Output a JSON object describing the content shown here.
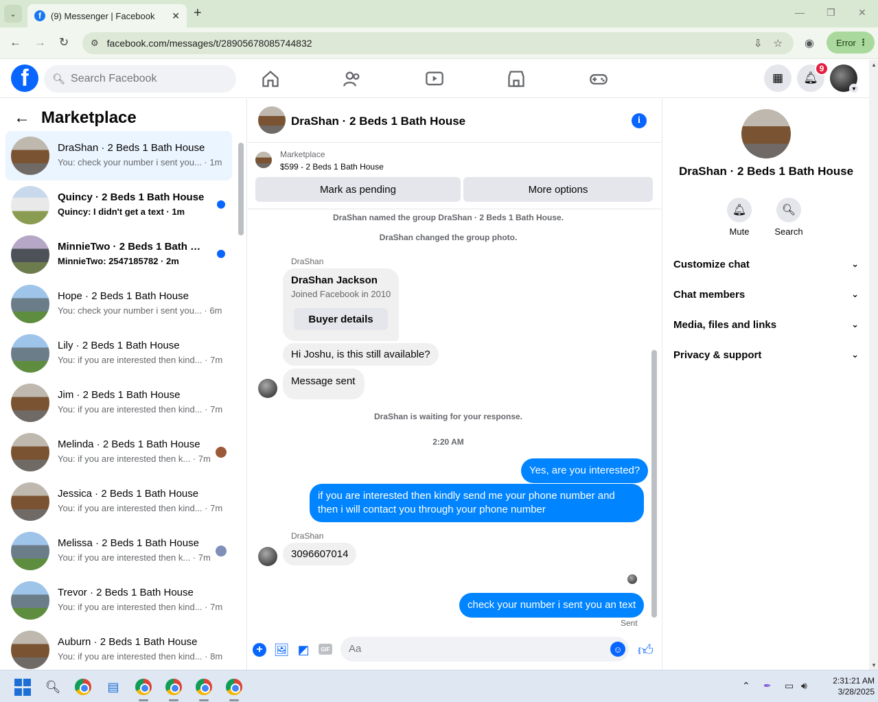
{
  "browser": {
    "tab_title": "(9) Messenger | Facebook",
    "url": "facebook.com/messages/t/28905678085744832",
    "error_label": "Error"
  },
  "fb_header": {
    "search_placeholder": "Search Facebook",
    "notification_count": "9"
  },
  "left_panel": {
    "title": "Marketplace",
    "conversations": [
      {
        "name": "DraShan · 2 Beds 1 Bath House",
        "preview": "You: check your number i sent you... · 1m",
        "thumb": "room",
        "active": true,
        "unread": false
      },
      {
        "name": "Quincy · 2 Beds 1 Bath House",
        "preview": "Quincy: I didn't get a text · 1m",
        "thumb": "white",
        "unread": true
      },
      {
        "name": "MinnieTwo · 2 Beds 1 Bath Ho...",
        "preview": "MinnieTwo: 2547185782 · 2m",
        "thumb": "gray",
        "unread": true
      },
      {
        "name": "Hope · 2 Beds 1 Bath House",
        "preview": "You: check your number i sent you... · 6m",
        "thumb": "house"
      },
      {
        "name": "Lily · 2 Beds 1 Bath House",
        "preview": "You: if you are interested then kind... · 7m",
        "thumb": "house"
      },
      {
        "name": "Jim · 2 Beds 1 Bath House",
        "preview": "You: if you are interested then kind... · 7m",
        "thumb": "room"
      },
      {
        "name": "Melinda · 2 Beds 1 Bath House",
        "preview": "You: if you are interested then k... · 7m",
        "thumb": "room",
        "mini": "#9a5a3a"
      },
      {
        "name": "Jessica · 2 Beds 1 Bath House",
        "preview": "You: if you are interested then kind... · 7m",
        "thumb": "room"
      },
      {
        "name": "Melissa · 2 Beds 1 Bath House",
        "preview": "You: if you are interested then k... · 7m",
        "thumb": "house",
        "mini": "#7f8fb8"
      },
      {
        "name": "Trevor · 2 Beds 1 Bath House",
        "preview": "You: if you are interested then kind... · 7m",
        "thumb": "house"
      },
      {
        "name": "Auburn · 2 Beds 1 Bath House",
        "preview": "You: if you are interested then kind... · 8m",
        "thumb": "room"
      }
    ]
  },
  "chat": {
    "header_name": "DraShan · 2 Beds 1 Bath House",
    "marketplace_label": "Marketplace",
    "listing": "$599 - 2 Beds 1 Bath House",
    "mark_pending": "Mark as pending",
    "more_options": "More options",
    "sys_named": "DraShan named the group DraShan · 2 Beds 1 Bath House.",
    "sys_photo": "DraShan changed the group photo.",
    "sender1": "DraShan",
    "card_name": "DraShan Jackson",
    "card_sub": "Joined Facebook in 2010",
    "card_button": "Buyer details",
    "msg_available": "Hi Joshu, is this still available?",
    "msg_sent": "Message sent",
    "sys_waiting": "DraShan is waiting for your response.",
    "time": "2:20 AM",
    "out1": "Yes, are you interested?",
    "out2_line1": "if you are interested then kindly send me your phone number and",
    "out2_line2": "then i will contact you through your phone number",
    "sender2": "DraShan",
    "msg_number": "3096607014",
    "out3": "check your number i sent you an text",
    "sent_status": "Sent",
    "composer_placeholder": "Aa"
  },
  "right_panel": {
    "name": "DraShan · 2 Beds 1 Bath House",
    "mute": "Mute",
    "search": "Search",
    "rows": [
      "Customize chat",
      "Chat members",
      "Media, files and links",
      "Privacy & support"
    ]
  },
  "taskbar": {
    "time": "2:31:21 AM",
    "date": "3/28/2025"
  }
}
